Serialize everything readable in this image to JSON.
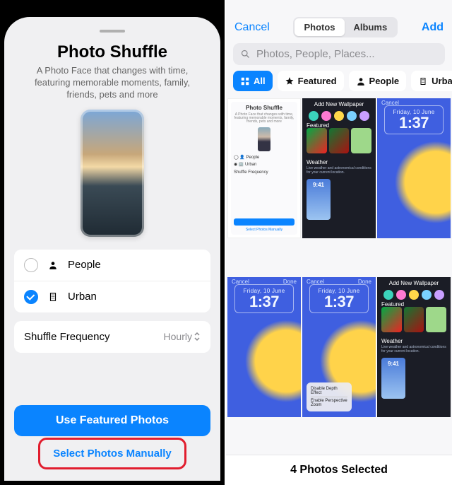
{
  "left": {
    "title": "Photo Shuffle",
    "subtitle": "A Photo Face that changes with time, featuring memorable moments, family, friends, pets and more",
    "options": {
      "people": {
        "label": "People",
        "checked": false
      },
      "urban": {
        "label": "Urban",
        "checked": true
      }
    },
    "shuffle_frequency_label": "Shuffle Frequency",
    "shuffle_frequency_value": "Hourly",
    "primary_button": "Use Featured Photos",
    "secondary_button": "Select Photos Manually"
  },
  "right": {
    "nav": {
      "cancel": "Cancel",
      "add": "Add",
      "tab_photos": "Photos",
      "tab_albums": "Albums"
    },
    "search_placeholder": "Photos, People, Places...",
    "chips": {
      "all": "All",
      "featured": "Featured",
      "people": "People",
      "urban": "Urban"
    },
    "thumbnails": [
      {
        "kind": "settings",
        "title": "Photo Shuffle"
      },
      {
        "kind": "add_wallpaper",
        "title": "Add New Wallpaper",
        "featured_label": "Featured",
        "weather_label": "Weather"
      },
      {
        "kind": "lockscreen",
        "cancel": "Cancel",
        "date": "Friday, 10 June",
        "time": "1:37"
      },
      {
        "kind": "lockscreen",
        "cancel": "Cancel",
        "done": "Done",
        "date": "Friday, 10 June",
        "time": "1:37"
      },
      {
        "kind": "lockscreen",
        "cancel": "Cancel",
        "done": "Done",
        "date": "Friday, 10 June",
        "time": "1:37",
        "menu": [
          "Disable Depth Effect",
          "Enable Perspective Zoom"
        ]
      },
      {
        "kind": "add_wallpaper",
        "title": "Add New Wallpaper",
        "featured_label": "Featured",
        "weather_label": "Weather"
      }
    ],
    "footer": "4 Photos Selected"
  }
}
